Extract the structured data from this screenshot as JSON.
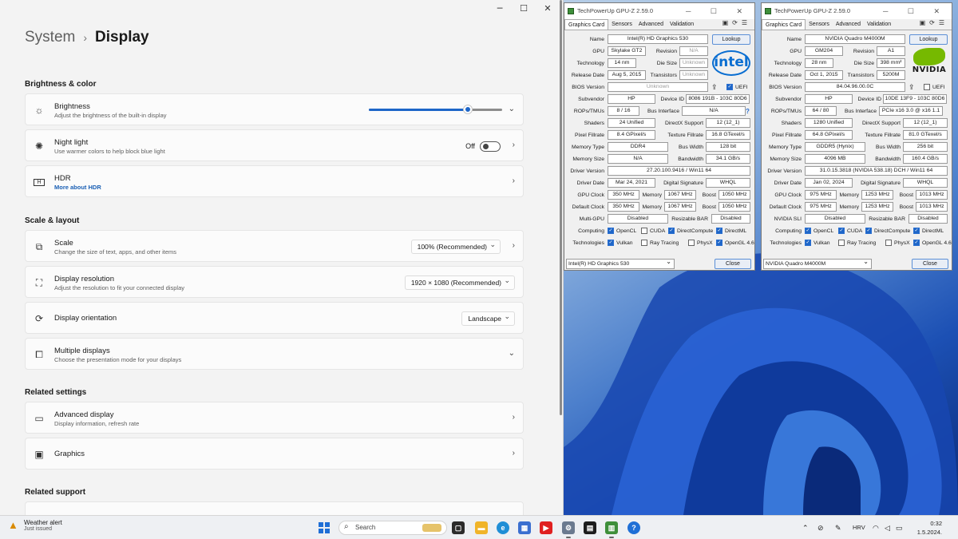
{
  "settings": {
    "breadcrumb_parent": "System",
    "breadcrumb_sep": "›",
    "page_title": "Display",
    "sections": {
      "brightness_color": "Brightness & color",
      "scale_layout": "Scale & layout",
      "related_settings": "Related settings",
      "related_support": "Related support"
    },
    "brightness": {
      "title": "Brightness",
      "subtitle": "Adjust the brightness of the built-in display",
      "level_pct": 74
    },
    "night_light": {
      "title": "Night light",
      "subtitle": "Use warmer colors to help block blue light",
      "state": "Off"
    },
    "hdr": {
      "title": "HDR",
      "link": "More about HDR"
    },
    "scale": {
      "title": "Scale",
      "subtitle": "Change the size of text, apps, and other items",
      "value": "100% (Recommended)"
    },
    "resolution": {
      "title": "Display resolution",
      "subtitle": "Adjust the resolution to fit your connected display",
      "value": "1920 × 1080 (Recommended)"
    },
    "orientation": {
      "title": "Display orientation",
      "value": "Landscape"
    },
    "multiple": {
      "title": "Multiple displays",
      "subtitle": "Choose the presentation mode for your displays"
    },
    "advanced": {
      "title": "Advanced display",
      "subtitle": "Display information, refresh rate"
    },
    "graphics": {
      "title": "Graphics"
    }
  },
  "gpuz_intel": {
    "title": "TechPowerUp GPU-Z 2.59.0",
    "tabs": [
      "Graphics Card",
      "Sensors",
      "Advanced",
      "Validation"
    ],
    "lookup": "Lookup",
    "labels": {
      "name": "Name",
      "gpu": "GPU",
      "revision": "Revision",
      "technology": "Technology",
      "die_size": "Die Size",
      "release_date": "Release Date",
      "transistors": "Transistors",
      "bios": "BIOS Version",
      "uefi": "UEFI",
      "subvendor": "Subvendor",
      "device_id": "Device ID",
      "rops": "ROPs/TMUs",
      "bus": "Bus Interface",
      "shaders": "Shaders",
      "directx": "DirectX Support",
      "pixel": "Pixel Fillrate",
      "texture": "Texture Fillrate",
      "mem_type": "Memory Type",
      "bus_width": "Bus Width",
      "mem_size": "Memory Size",
      "bandwidth": "Bandwidth",
      "driver_ver": "Driver Version",
      "driver_date": "Driver Date",
      "dig_sig": "Digital Signature",
      "gpu_clock": "GPU Clock",
      "memory": "Memory",
      "boost": "Boost",
      "default_clock": "Default Clock",
      "multi": "Multi-GPU",
      "rebar": "Resizable BAR",
      "computing": "Computing",
      "technologies": "Technologies"
    },
    "name": "Intel(R) HD Graphics 530",
    "gpu": "Skylake GT2",
    "revision": "N/A",
    "technology": "14 nm",
    "die_size": "Unknown",
    "release_date": "Aug 5, 2015",
    "transistors": "Unknown",
    "bios": "Unknown",
    "subvendor": "HP",
    "device_id": "8086 191B - 103C 80D6",
    "rops": "8 / 16",
    "bus": "N/A",
    "shaders": "24 Unified",
    "directx": "12 (12_1)",
    "pixel": "8.4 GPixel/s",
    "texture": "16.8 GTexel/s",
    "mem_type": "DDR4",
    "bus_width": "128 bit",
    "mem_size": "N/A",
    "bandwidth": "34.1 GB/s",
    "driver_ver": "27.20.100.9416 / Win11 64",
    "driver_date": "Mar 24, 2021",
    "dig_sig": "WHQL",
    "gpu_clock": "350 MHz",
    "gpu_mem": "1067 MHz",
    "gpu_boost": "1050 MHz",
    "def_clock": "350 MHz",
    "def_mem": "1067 MHz",
    "def_boost": "1050 MHz",
    "multi": "Disabled",
    "rebar": "Disabled",
    "compute": [
      "OpenCL",
      "CUDA",
      "DirectCompute",
      "DirectML"
    ],
    "compute_on": [
      true,
      false,
      true,
      true
    ],
    "tech": [
      "Vulkan",
      "Ray Tracing",
      "PhysX",
      "OpenGL 4.6"
    ],
    "tech_on": [
      true,
      false,
      false,
      true
    ],
    "select": "Intel(R) HD Graphics 530",
    "close": "Close",
    "logo": "intel"
  },
  "gpuz_nvidia": {
    "title": "TechPowerUp GPU-Z 2.59.0",
    "tabs": [
      "Graphics Card",
      "Sensors",
      "Advanced",
      "Validation"
    ],
    "lookup": "Lookup",
    "labels": {
      "name": "Name",
      "gpu": "GPU",
      "revision": "Revision",
      "technology": "Technology",
      "die_size": "Die Size",
      "release_date": "Release Date",
      "transistors": "Transistors",
      "bios": "BIOS Version",
      "uefi": "UEFI",
      "subvendor": "Subvendor",
      "device_id": "Device ID",
      "rops": "ROPs/TMUs",
      "bus": "Bus Interface",
      "shaders": "Shaders",
      "directx": "DirectX Support",
      "pixel": "Pixel Fillrate",
      "texture": "Texture Fillrate",
      "mem_type": "Memory Type",
      "bus_width": "Bus Width",
      "mem_size": "Memory Size",
      "bandwidth": "Bandwidth",
      "driver_ver": "Driver Version",
      "driver_date": "Driver Date",
      "dig_sig": "Digital Signature",
      "gpu_clock": "GPU Clock",
      "memory": "Memory",
      "boost": "Boost",
      "default_clock": "Default Clock",
      "multi": "NVIDIA SLI",
      "rebar": "Resizable BAR",
      "computing": "Computing",
      "technologies": "Technologies"
    },
    "name": "NVIDIA Quadro M4000M",
    "gpu": "GM204",
    "revision": "A1",
    "technology": "28 nm",
    "die_size": "398 mm²",
    "release_date": "Oct 1, 2015",
    "transistors": "5200M",
    "bios": "84.04.96.00.0C",
    "subvendor": "HP",
    "device_id": "10DE 13F9 - 103C 80D6",
    "rops": "64 / 80",
    "bus": "PCIe x16 3.0 @ x16 1.1",
    "shaders": "1280 Unified",
    "directx": "12 (12_1)",
    "pixel": "64.8 GPixel/s",
    "texture": "81.0 GTexel/s",
    "mem_type": "GDDR5 (Hynix)",
    "bus_width": "256 bit",
    "mem_size": "4096 MB",
    "bandwidth": "160.4 GB/s",
    "driver_ver": "31.0.15.3818 (NVIDIA 538.18) DCH / Win11 64",
    "driver_date": "Jan 02, 2024",
    "dig_sig": "WHQL",
    "gpu_clock": "975 MHz",
    "gpu_mem": "1253 MHz",
    "gpu_boost": "1013 MHz",
    "def_clock": "975 MHz",
    "def_mem": "1253 MHz",
    "def_boost": "1013 MHz",
    "multi": "Disabled",
    "rebar": "Disabled",
    "compute": [
      "OpenCL",
      "CUDA",
      "DirectCompute",
      "DirectML"
    ],
    "compute_on": [
      true,
      true,
      true,
      true
    ],
    "tech": [
      "Vulkan",
      "Ray Tracing",
      "PhysX",
      "OpenGL 4.6"
    ],
    "tech_on": [
      true,
      false,
      false,
      true
    ],
    "select": "NVIDIA Quadro M4000M",
    "close": "Close",
    "logo": "NVIDIA"
  },
  "taskbar": {
    "weather_title": "Weather alert",
    "weather_sub": "Just issued",
    "search": "Search",
    "lang": "HRV",
    "time": "0:32",
    "date": "1.5.2024."
  },
  "colors": {
    "accent": "#1e66c8",
    "nvidia_green": "#76b900",
    "intel_blue": "#0a6ed1"
  }
}
